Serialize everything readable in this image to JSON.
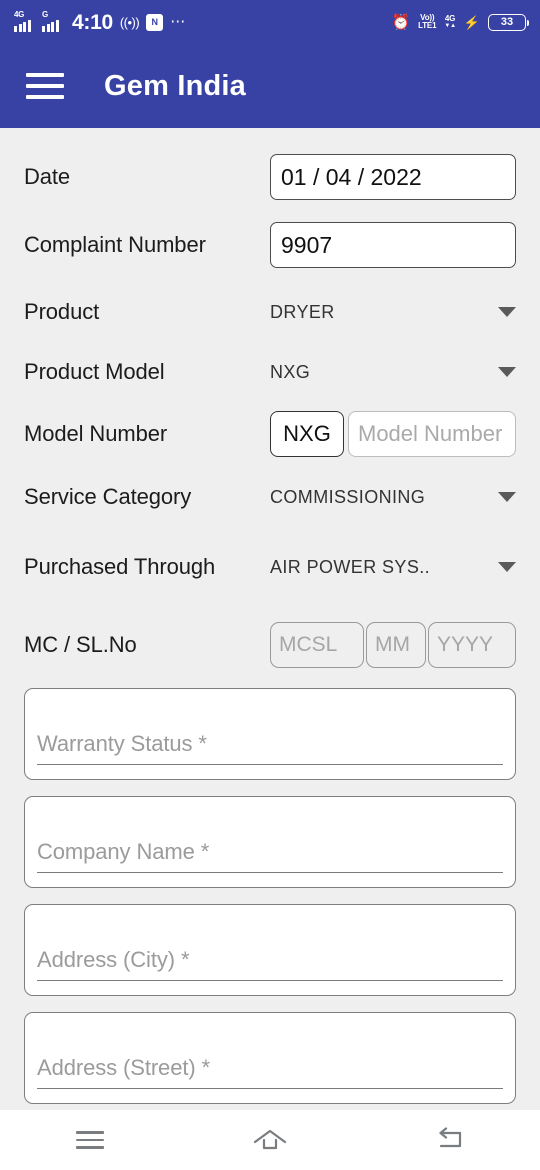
{
  "colors": {
    "appbar_blue": "#3842A4",
    "page_background": "#EFEFEF",
    "field_border": "#7E7E7E",
    "placeholder_grey": "#9B9B9B",
    "navbar_icon": "#7A7D80"
  },
  "status_bar": {
    "network_primary": "4G",
    "network_secondary": "G",
    "time": "4:10",
    "wifi_icon": "wifi-hotspot-icon",
    "nfc_icon": "nfc-icon",
    "more_icon": "more-dots-icon",
    "alarm_icon": "alarm-clock-icon",
    "volte_line1": "Vo))",
    "volte_line2": "LTE1",
    "data_line1": "4G",
    "data_line2": "▼▲",
    "charging_icon": "charging-bolt-icon",
    "battery_level": "33"
  },
  "app_bar": {
    "menu_icon": "hamburger-menu-icon",
    "title": "Gem India"
  },
  "form": {
    "rows": [
      {
        "type": "text",
        "label": "Date",
        "name": "date",
        "value": "01 / 04 / 2022",
        "placeholder": ""
      },
      {
        "type": "text",
        "label": "Complaint Number",
        "name": "complaint-number",
        "value": "9907",
        "placeholder": ""
      },
      {
        "type": "select",
        "label": "Product",
        "name": "product",
        "value": "DRYER"
      },
      {
        "type": "select",
        "label": "Product Model",
        "name": "product-model",
        "value": "NXG"
      },
      {
        "type": "prefixed",
        "label": "Model Number",
        "name": "model-number",
        "prefix": "NXG",
        "value": "",
        "placeholder": "Model Number"
      },
      {
        "type": "select",
        "label": "Service Category",
        "name": "service-category",
        "value": "COMMISSIONING"
      },
      {
        "type": "select",
        "label": "Purchased Through",
        "name": "purchased-through",
        "value": "AIR POWER SYS.."
      },
      {
        "type": "group",
        "label": "MC / SL.No",
        "name": "mc-sl-no",
        "fields": [
          {
            "name": "mcsl",
            "placeholder": "MCSL",
            "value": ""
          },
          {
            "name": "mm",
            "placeholder": "MM",
            "value": ""
          },
          {
            "name": "yyyy",
            "placeholder": "YYYY",
            "value": ""
          }
        ]
      }
    ],
    "cards": [
      {
        "name": "warranty-status",
        "placeholder": "Warranty Status *",
        "value": ""
      },
      {
        "name": "company-name",
        "placeholder": "Company Name *",
        "value": ""
      },
      {
        "name": "address-city",
        "placeholder": "Address (City) *",
        "value": ""
      },
      {
        "name": "address-street",
        "placeholder": "Address (Street) *",
        "value": ""
      }
    ]
  },
  "nav_bar": {
    "recents_icon": "recents-menu-icon",
    "home_icon": "home-icon",
    "back_icon": "back-arrow-icon"
  }
}
